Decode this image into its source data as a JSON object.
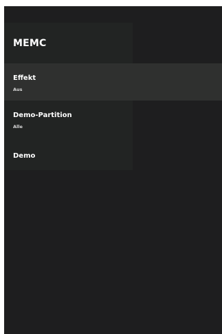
{
  "page": {
    "title": "MEMC"
  },
  "menu": {
    "items": [
      {
        "label": "Effekt",
        "value": "Aus",
        "selected": true
      },
      {
        "label": "Demo-Partition",
        "value": "Alle",
        "selected": false
      },
      {
        "label": "Demo",
        "value": "",
        "selected": false
      }
    ]
  },
  "colors": {
    "screen_background": "#1e1e1f",
    "panel_background": "#222423",
    "selected_row": "#2f302f",
    "text_primary": "#ffffff",
    "text_secondary": "#d9d9d9"
  }
}
